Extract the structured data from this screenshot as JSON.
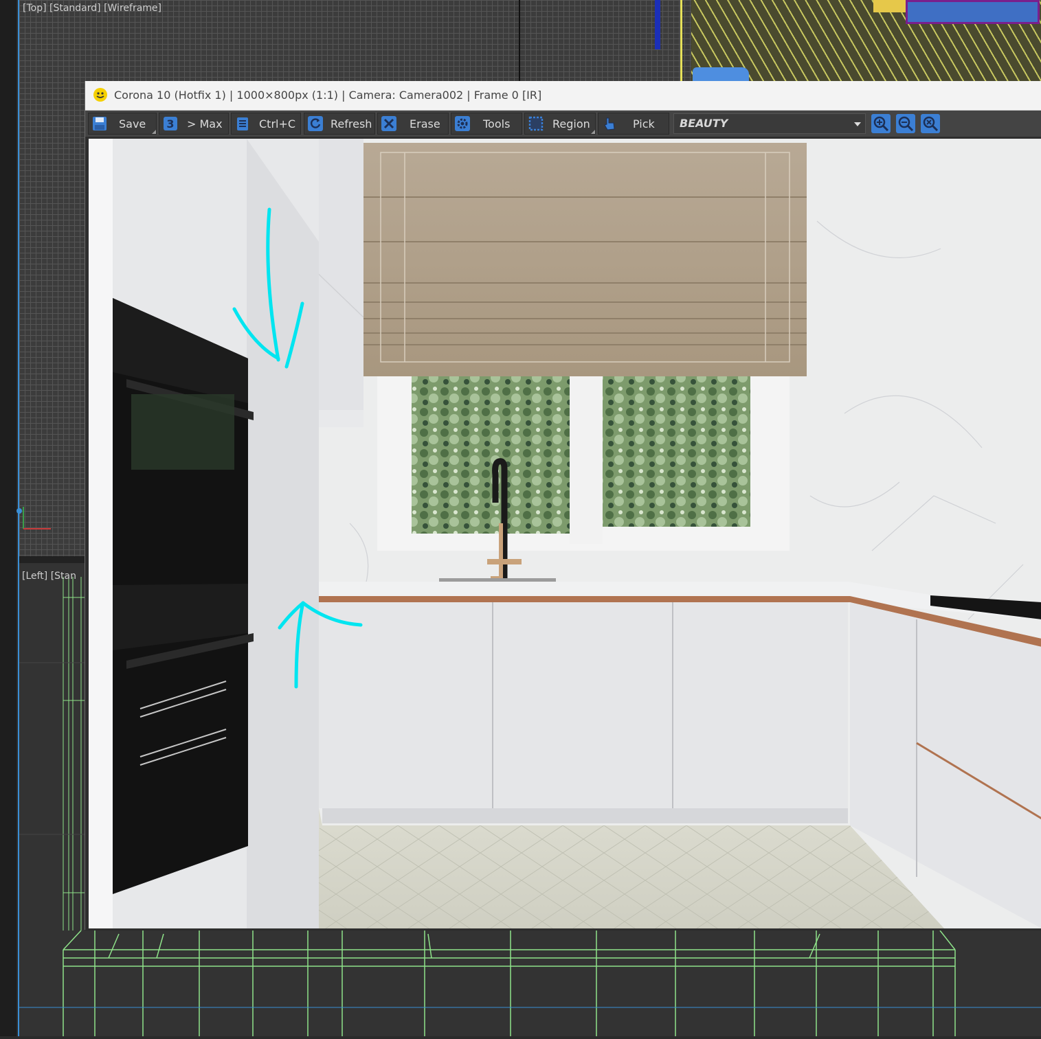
{
  "viewports": {
    "top_label": "[Top] [Standard] [Wireframe]",
    "left_label": "[Left] [Stan"
  },
  "vfb": {
    "title": "Corona 10 (Hotfix 1) | 1000×800px (1:1) | Camera: Camera002 | Frame 0 [IR]",
    "title_icon": "corona-logo-icon",
    "toolbar": {
      "save": {
        "label": "Save",
        "icon": "floppy-disk-icon"
      },
      "to_max": {
        "label": "> Max",
        "icon": "max-3-icon"
      },
      "copy": {
        "label": "Ctrl+C",
        "icon": "clipboard-icon"
      },
      "refresh": {
        "label": "Refresh",
        "icon": "refresh-icon"
      },
      "erase": {
        "label": "Erase",
        "icon": "x-icon"
      },
      "tools": {
        "label": "Tools",
        "icon": "gear-icon"
      },
      "region": {
        "label": "Region",
        "icon": "region-select-icon"
      },
      "pick": {
        "label": "Pick",
        "icon": "hand-pointer-icon"
      },
      "render_pass": "BEAUTY",
      "zoom_in_icon": "zoom-in-icon",
      "zoom_out_icon": "zoom-out-icon",
      "zoom_fit_icon": "zoom-fit-icon"
    }
  },
  "annotation": {
    "color": "#00e5f0",
    "arrows": [
      "arrow-down-icon",
      "arrow-up-icon"
    ]
  },
  "colors": {
    "accent_blue": "#3a8fd6",
    "toolbar_icon_blue": "#3b7fd4",
    "wireframe_green": "#8fe38a",
    "corona_yellow": "#f5d000"
  }
}
